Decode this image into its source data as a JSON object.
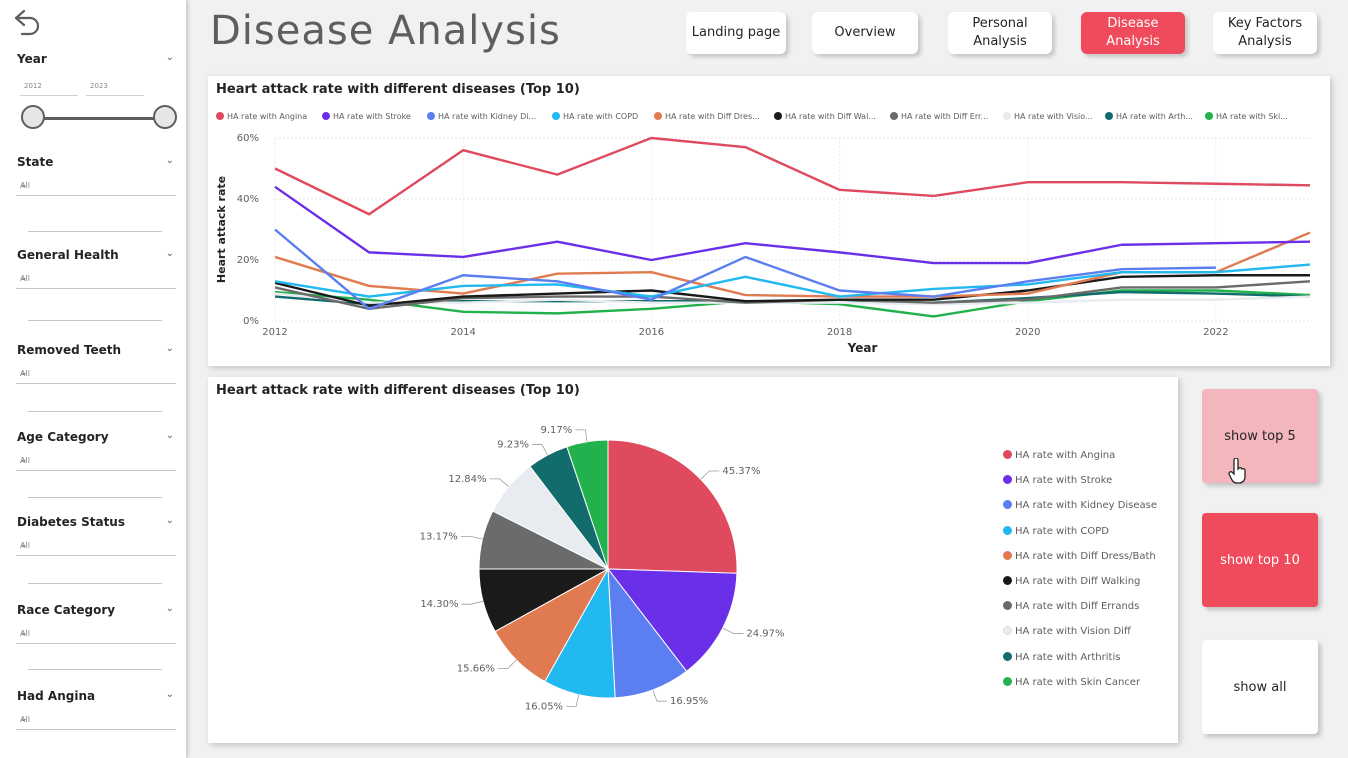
{
  "header": {
    "title": "Disease Analysis"
  },
  "nav": [
    {
      "label": "Landing page",
      "active": false
    },
    {
      "label": "Overview",
      "active": false
    },
    {
      "label": "Personal\nAnalysis",
      "active": false
    },
    {
      "label": "Disease\nAnalysis",
      "active": true
    },
    {
      "label": "Key Factors\nAnalysis",
      "active": false
    }
  ],
  "sidebar": {
    "year": {
      "title": "Year",
      "from": "2012",
      "to": "2023"
    },
    "filters": [
      {
        "title": "State",
        "value": "All"
      },
      {
        "title": "General Health",
        "value": "All"
      },
      {
        "title": "Removed Teeth",
        "value": "All"
      },
      {
        "title": "Age Category",
        "value": "All"
      },
      {
        "title": "Diabetes Status",
        "value": "All"
      },
      {
        "title": "Race Category",
        "value": "All"
      },
      {
        "title": "Had Angina",
        "value": "All"
      }
    ]
  },
  "line_card": {
    "title": "Heart attack rate with different diseases (Top 10)"
  },
  "pie_card": {
    "title": "Heart attack rate with different diseases (Top 10)"
  },
  "buttons": {
    "top5": "show top 5",
    "top10": "show top 10",
    "all": "show all"
  },
  "colors": {
    "accent": "#ef4b5d",
    "top5_bg": "#f4b6bd",
    "series": [
      "#e04a5f",
      "#6a2fe8",
      "#5b7ef0",
      "#22b8f0",
      "#e07a50",
      "#1a1a1a",
      "#6b6b6b",
      "#e8ecf0",
      "#136c6c",
      "#22b14c"
    ]
  },
  "chart_data": [
    {
      "type": "line",
      "title": "Heart attack rate with different diseases (Top 10)",
      "xlabel": "Year",
      "ylabel": "Heart attack rate",
      "ylim": [
        0,
        60
      ],
      "yticks": [
        "0%",
        "20%",
        "40%",
        "60%"
      ],
      "xticks": [
        "2012",
        "2014",
        "2016",
        "2018",
        "2020",
        "2022"
      ],
      "x": [
        2012,
        2013,
        2014,
        2015,
        2016,
        2017,
        2018,
        2019,
        2020,
        2021,
        2022,
        2023
      ],
      "grid": true,
      "legend_position": "top",
      "series": [
        {
          "name": "HA rate with Angina",
          "legend_label": "HA rate with Angina",
          "values": [
            50,
            35,
            56,
            48,
            60,
            57,
            43,
            41,
            45.5,
            45.5,
            45,
            44.5
          ]
        },
        {
          "name": "HA rate with Stroke",
          "legend_label": "HA rate with Stroke",
          "values": [
            44,
            22.5,
            21,
            26,
            20,
            25.5,
            22.5,
            19,
            19,
            25,
            25.5,
            26
          ]
        },
        {
          "name": "HA rate with Kidney Disease",
          "legend_label": "HA rate with Kidney Di...",
          "values": [
            30,
            4,
            15,
            13,
            7,
            21,
            10,
            8,
            13,
            17,
            17.5,
            null
          ]
        },
        {
          "name": "HA rate with COPD",
          "legend_label": "HA rate with COPD",
          "values": [
            13,
            8,
            11.5,
            12,
            8,
            14.5,
            8,
            10.5,
            12,
            16,
            16,
            18.5
          ]
        },
        {
          "name": "HA rate with Diff Dress/Bath",
          "legend_label": "HA rate with Diff Dres...",
          "values": [
            21,
            11.5,
            9,
            15.5,
            16,
            8.5,
            8,
            8,
            9,
            16,
            16,
            29
          ]
        },
        {
          "name": "HA rate with Diff Walking",
          "legend_label": "HA rate with Diff Wal...",
          "values": [
            12.5,
            5,
            8,
            9,
            10,
            6.5,
            7,
            7,
            10,
            14.5,
            15,
            15
          ]
        },
        {
          "name": "HA rate with Diff Errands",
          "legend_label": "HA rate with Diff Err...",
          "values": [
            11,
            4,
            7.5,
            8,
            8,
            6,
            7,
            6,
            7,
            11,
            11,
            13
          ]
        },
        {
          "name": "HA rate with Vision Diff",
          "legend_label": "HA rate with Visio...",
          "values": [
            9,
            6,
            6,
            7,
            6,
            6,
            6,
            5.5,
            6,
            7,
            7,
            8
          ]
        },
        {
          "name": "HA rate with Arthritis",
          "legend_label": "HA rate with Arth...",
          "values": [
            8,
            5.5,
            6.5,
            6.5,
            6.5,
            6.5,
            6,
            6,
            7.5,
            9.5,
            9,
            8
          ]
        },
        {
          "name": "HA rate with Skin Cancer",
          "legend_label": "HA rate with Ski...",
          "values": [
            9.5,
            7,
            3,
            2.5,
            4,
            6.5,
            5.5,
            1.5,
            6.5,
            10,
            10,
            8.5
          ]
        }
      ]
    },
    {
      "type": "pie",
      "title": "Heart attack rate with different diseases (Top 10)",
      "labels": [
        "HA rate with Angina",
        "HA rate with Stroke",
        "HA rate with Kidney Disease",
        "HA rate with COPD",
        "HA rate with Diff Dress/Bath",
        "HA rate with Diff Walking",
        "HA rate with Diff Errands",
        "HA rate with Vision Diff",
        "HA rate with Arthritis",
        "HA rate with Skin Cancer"
      ],
      "values": [
        45.37,
        24.97,
        16.95,
        16.05,
        15.66,
        14.3,
        13.17,
        12.84,
        9.23,
        9.17
      ],
      "value_labels": [
        "45.37%",
        "24.97%",
        "16.95%",
        "16.05%",
        "15.66%",
        "14.30%",
        "13.17%",
        "12.84%",
        "9.23%",
        "9.17%"
      ],
      "legend_position": "right"
    }
  ]
}
